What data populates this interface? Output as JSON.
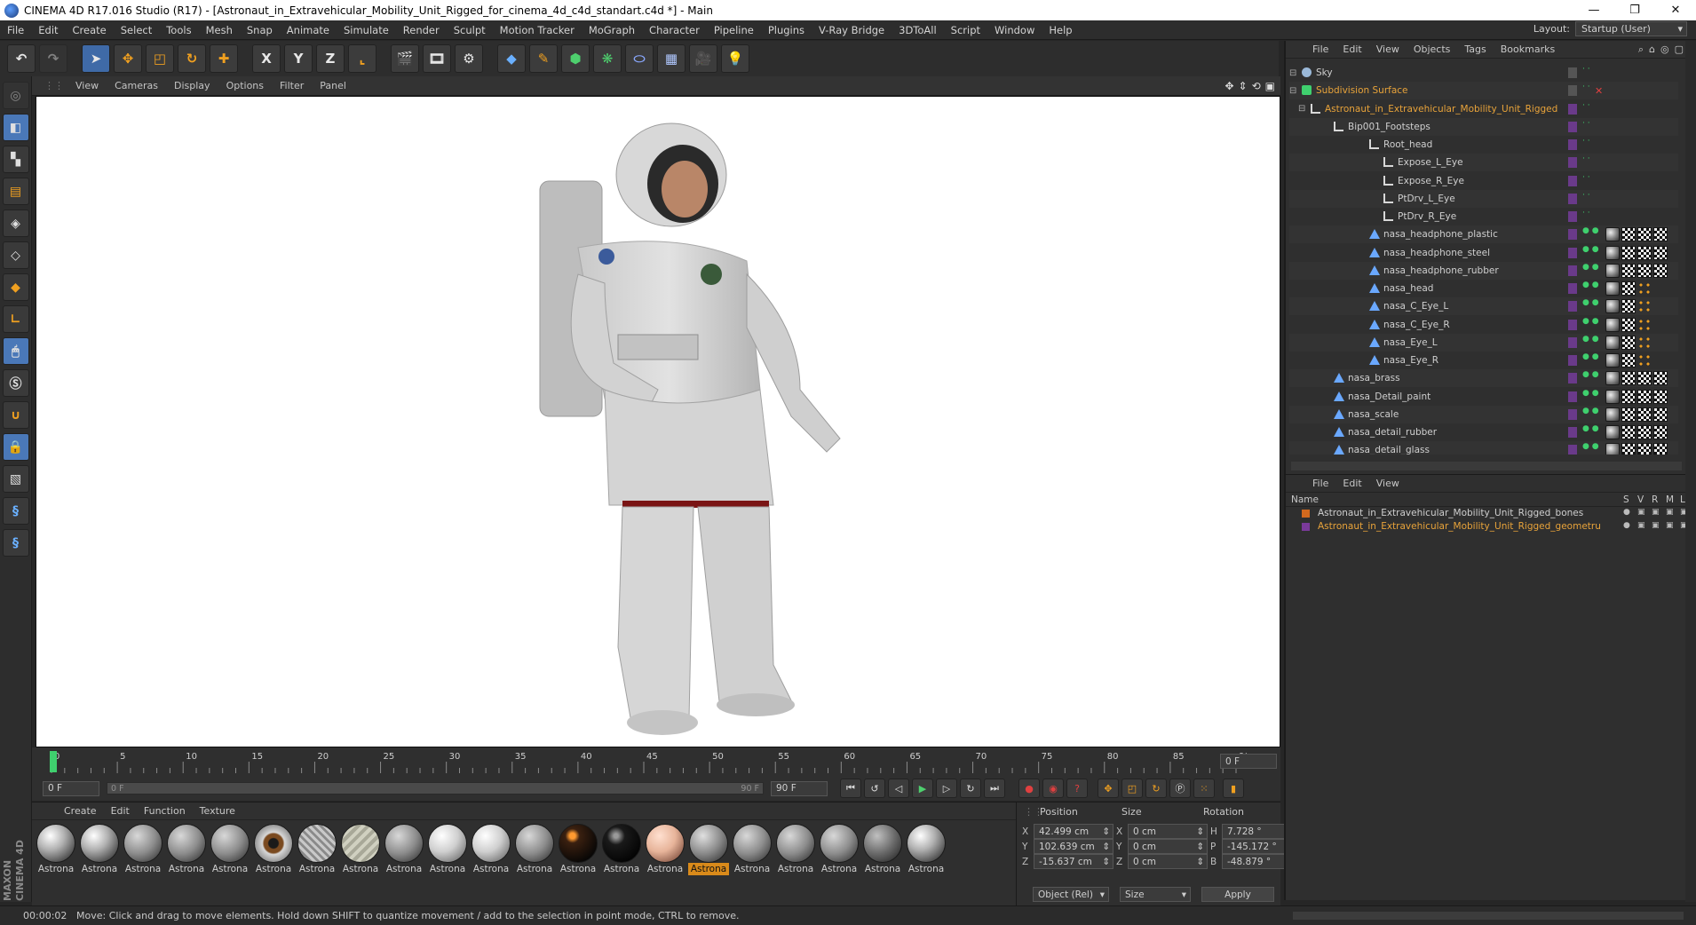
{
  "window": {
    "title": "CINEMA 4D R17.016 Studio (R17) - [Astronaut_in_Extravehicular_Mobility_Unit_Rigged_for_cinema_4d_c4d_standart.c4d *] - Main",
    "minimize": "—",
    "restore": "❐",
    "close": "✕"
  },
  "menubar": {
    "items": [
      "File",
      "Edit",
      "Create",
      "Select",
      "Tools",
      "Mesh",
      "Snap",
      "Animate",
      "Simulate",
      "Render",
      "Sculpt",
      "Motion Tracker",
      "MoGraph",
      "Character",
      "Pipeline",
      "Plugins",
      "V-Ray Bridge",
      "3DToAll",
      "Script",
      "Window",
      "Help"
    ],
    "layout_label": "Layout:",
    "layout_value": "Startup (User)"
  },
  "toolbar": {
    "x_label": "X",
    "y_label": "Y",
    "z_label": "Z"
  },
  "viewport": {
    "menu": [
      "View",
      "Cameras",
      "Display",
      "Options",
      "Filter",
      "Panel"
    ]
  },
  "timeline": {
    "ticks": [
      "0",
      "5",
      "10",
      "15",
      "20",
      "25",
      "30",
      "35",
      "40",
      "45",
      "50",
      "55",
      "60",
      "65",
      "70",
      "75",
      "80",
      "85",
      "90"
    ],
    "current_frame": "0 F"
  },
  "transport": {
    "start_field": "0 F",
    "slider_left": "0 F",
    "slider_right": "90 F",
    "end_field": "90 F"
  },
  "material_manager": {
    "menu": [
      "Create",
      "Edit",
      "Function",
      "Texture"
    ],
    "materials": [
      {
        "label": "Astrona",
        "kind": "chrome"
      },
      {
        "label": "Astrona",
        "kind": "chrome"
      },
      {
        "label": "Astrona",
        "kind": "grey"
      },
      {
        "label": "Astrona",
        "kind": "grey"
      },
      {
        "label": "Astrona",
        "kind": "grey"
      },
      {
        "label": "Astrona",
        "kind": "eye"
      },
      {
        "label": "Astrona",
        "kind": "mesh"
      },
      {
        "label": "Astrona",
        "kind": "stripe"
      },
      {
        "label": "Astrona",
        "kind": "grey"
      },
      {
        "label": "Astrona",
        "kind": "light"
      },
      {
        "label": "Astrona",
        "kind": "light"
      },
      {
        "label": "Astrona",
        "kind": "grey"
      },
      {
        "label": "Astrona",
        "kind": "black-orange"
      },
      {
        "label": "Astrona",
        "kind": "black"
      },
      {
        "label": "Astrona",
        "kind": "skin"
      },
      {
        "label": "Astrona",
        "kind": "selected"
      },
      {
        "label": "Astrona",
        "kind": "grey"
      },
      {
        "label": "Astrona",
        "kind": "grey"
      },
      {
        "label": "Astrona",
        "kind": "grey"
      },
      {
        "label": "Astrona",
        "kind": "dark"
      },
      {
        "label": "Astrona",
        "kind": "chrome"
      }
    ]
  },
  "coordinates": {
    "headers": {
      "position": "Position",
      "size": "Size",
      "rotation": "Rotation"
    },
    "rows": [
      {
        "axis": "X",
        "pos": "42.499 cm",
        "size_axis": "X",
        "size": "0 cm",
        "rot_axis": "H",
        "rot": "7.728 °"
      },
      {
        "axis": "Y",
        "pos": "102.639 cm",
        "size_axis": "Y",
        "size": "0 cm",
        "rot_axis": "P",
        "rot": "-145.172 °"
      },
      {
        "axis": "Z",
        "pos": "-15.637 cm",
        "size_axis": "Z",
        "size": "0 cm",
        "rot_axis": "B",
        "rot": "-48.879 °"
      }
    ],
    "mode": "Object (Rel)",
    "size_mode": "Size",
    "apply": "Apply"
  },
  "object_manager": {
    "menu": [
      "File",
      "Edit",
      "View",
      "Objects",
      "Tags",
      "Bookmarks"
    ],
    "objects": [
      {
        "name": "Sky",
        "depth": 0,
        "hl": false,
        "icon": "sky",
        "tags": []
      },
      {
        "name": "Subdivision Surface",
        "depth": 0,
        "hl": true,
        "icon": "subdiv",
        "tags": []
      },
      {
        "name": "Astronaut_in_Extravehicular_Mobility_Unit_Rigged",
        "depth": 1,
        "hl": true,
        "icon": "null",
        "tags": []
      },
      {
        "name": "Bip001_Footsteps",
        "depth": 2,
        "hl": false,
        "icon": "null",
        "tags": []
      },
      {
        "name": "Root_head",
        "depth": 3,
        "hl": false,
        "icon": "null",
        "tags": []
      },
      {
        "name": "Expose_L_Eye",
        "depth": 4,
        "hl": false,
        "icon": "null",
        "tags": []
      },
      {
        "name": "Expose_R_Eye",
        "depth": 4,
        "hl": false,
        "icon": "null",
        "tags": []
      },
      {
        "name": "PtDrv_L_Eye",
        "depth": 4,
        "hl": false,
        "icon": "null",
        "tags": []
      },
      {
        "name": "PtDrv_R_Eye",
        "depth": 4,
        "hl": false,
        "icon": "null",
        "tags": []
      },
      {
        "name": "nasa_headphone_plastic",
        "depth": 3,
        "hl": false,
        "icon": "mesh",
        "tags": [
          "sph",
          "chk",
          "chk",
          "chk"
        ]
      },
      {
        "name": "nasa_headphone_steel",
        "depth": 3,
        "hl": false,
        "icon": "mesh",
        "tags": [
          "sph",
          "chk",
          "chk",
          "chk"
        ]
      },
      {
        "name": "nasa_headphone_rubber",
        "depth": 3,
        "hl": false,
        "icon": "mesh",
        "tags": [
          "sph",
          "chk",
          "chk",
          "chk"
        ]
      },
      {
        "name": "nasa_head",
        "depth": 3,
        "hl": false,
        "icon": "mesh",
        "tags": [
          "sph",
          "chk",
          "dots"
        ]
      },
      {
        "name": "nasa_C_Eye_L",
        "depth": 3,
        "hl": false,
        "icon": "mesh",
        "tags": [
          "sph",
          "chk",
          "dots"
        ]
      },
      {
        "name": "nasa_C_Eye_R",
        "depth": 3,
        "hl": false,
        "icon": "mesh",
        "tags": [
          "sph",
          "chk",
          "dots"
        ]
      },
      {
        "name": "nasa_Eye_L",
        "depth": 3,
        "hl": false,
        "icon": "mesh",
        "tags": [
          "sph",
          "chk",
          "dots"
        ]
      },
      {
        "name": "nasa_Eye_R",
        "depth": 3,
        "hl": false,
        "icon": "mesh",
        "tags": [
          "sph",
          "chk",
          "dots"
        ]
      },
      {
        "name": "nasa_brass",
        "depth": 2,
        "hl": false,
        "icon": "mesh",
        "tags": [
          "sph",
          "chk",
          "chk",
          "chk"
        ]
      },
      {
        "name": "nasa_Detail_paint",
        "depth": 2,
        "hl": false,
        "icon": "mesh",
        "tags": [
          "sph",
          "chk",
          "chk",
          "chk"
        ]
      },
      {
        "name": "nasa_scale",
        "depth": 2,
        "hl": false,
        "icon": "mesh",
        "tags": [
          "sph",
          "chk",
          "chk",
          "chk"
        ]
      },
      {
        "name": "nasa_detail_rubber",
        "depth": 2,
        "hl": false,
        "icon": "mesh",
        "tags": [
          "sph",
          "chk",
          "chk",
          "chk"
        ]
      },
      {
        "name": "nasa_detail_glass",
        "depth": 2,
        "hl": false,
        "icon": "mesh",
        "tags": [
          "sph",
          "chk",
          "chk",
          "chk"
        ]
      }
    ]
  },
  "layer_manager": {
    "menu": [
      "File",
      "Edit",
      "View"
    ],
    "columns": {
      "name": "Name",
      "s": "S",
      "v": "V",
      "r": "R",
      "m": "M",
      "l": "L"
    },
    "layers": [
      {
        "name": "Astronaut_in_Extravehicular_Mobility_Unit_Rigged_bones",
        "color": "#d2691e",
        "hl": false
      },
      {
        "name": "Astronaut_in_Extravehicular_Mobility_Unit_Rigged_geometru",
        "color": "#7a3a9a",
        "hl": true
      }
    ]
  },
  "status": {
    "time": "00:00:02",
    "message": "Move: Click and drag to move elements. Hold down SHIFT to quantize movement / add to the selection in point mode, CTRL to remove."
  },
  "branding": {
    "line1": "MAXON",
    "line2": "CINEMA 4D"
  },
  "colors": {
    "accent": "#e8a33a",
    "selection": "#4a78b8",
    "viewport_bg": "#ffffff",
    "panel": "#2f2f2f"
  }
}
